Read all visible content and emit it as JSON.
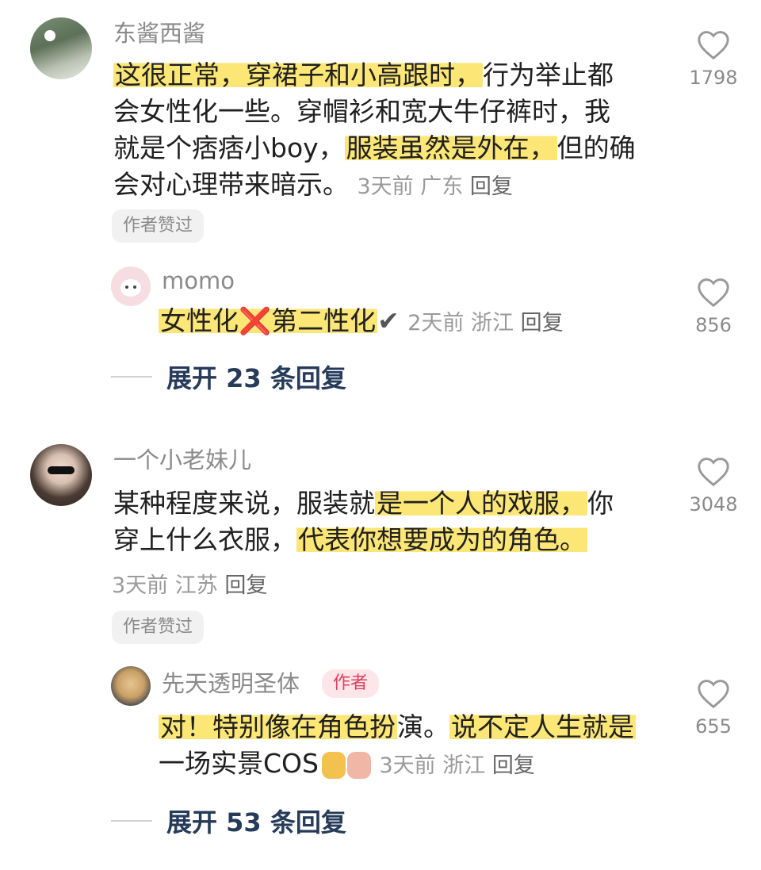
{
  "comments": [
    {
      "username": "东酱西酱",
      "text": [
        "这很正常，穿裙子和小高跟时，",
        "行为举止都",
        "会女性化一些。穿帽衫和宽大牛仔裤时，我",
        "就是个痞痞小boy，",
        "服装虽然是外在，",
        "但的确",
        "会对心理带来暗示。"
      ],
      "time": "3天前",
      "location": "广东",
      "reply_label": "回复",
      "author_liked": "作者赞过",
      "likes": "1798",
      "reply": {
        "username": "momo",
        "text": [
          "女性化",
          "❌",
          "第二性化",
          "✔"
        ],
        "time": "2天前",
        "location": "浙江",
        "reply_label": "回复",
        "likes": "856"
      },
      "expand_label": "展开 23 条回复"
    },
    {
      "username": "一个小老妹儿",
      "text": [
        "某种程度来说，服装就",
        "是一个人的戏服，",
        "你",
        "穿上什么衣服，",
        "代表你想要成为的角色。"
      ],
      "time": "3天前",
      "location": "江苏",
      "reply_label": "回复",
      "author_liked": "作者赞过",
      "likes": "3048",
      "reply": {
        "username": "先天透明圣体",
        "author_tag": "作者",
        "text": [
          "对！特别像在角色扮",
          "演。",
          "说不定人生就是",
          "一场实景COS"
        ],
        "time": "3天前",
        "location": "浙江",
        "reply_label": "回复",
        "likes": "655"
      },
      "expand_label": "展开 53 条回复"
    }
  ],
  "icons": {
    "like": "heart-outline-icon"
  },
  "colors": {
    "highlight": "#fbe676",
    "username": "#8a8a8a",
    "expand": "#263a5a",
    "author_tag_bg": "#fde6ea",
    "author_tag_text": "#e04060"
  }
}
